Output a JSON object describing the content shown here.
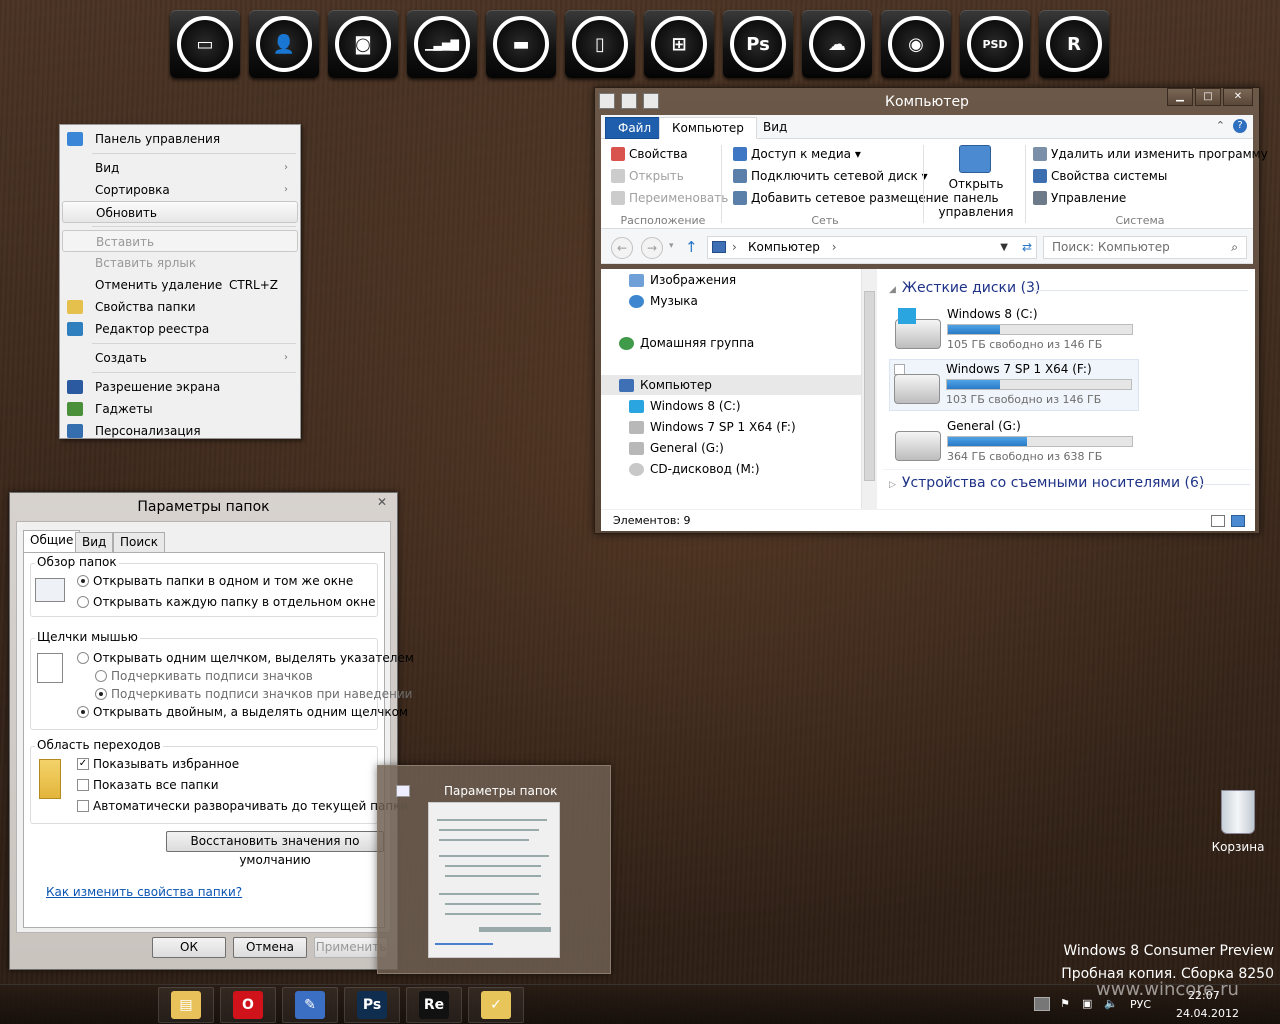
{
  "dock": {
    "icons": [
      {
        "name": "monitor-icon",
        "glyph": "▭"
      },
      {
        "name": "user-icon",
        "glyph": "👤"
      },
      {
        "name": "camera-icon",
        "glyph": "◙"
      },
      {
        "name": "signal-bars-icon",
        "glyph": "▁▃▅▇"
      },
      {
        "name": "folder-icon",
        "glyph": "▬"
      },
      {
        "name": "phone-icon",
        "glyph": "▯"
      },
      {
        "name": "windows-logo-icon",
        "glyph": "⊞"
      },
      {
        "name": "photoshop-icon",
        "glyph": "Ps"
      },
      {
        "name": "cloud-icon",
        "glyph": "☁"
      },
      {
        "name": "eye-icon",
        "glyph": "◉"
      },
      {
        "name": "psd-file-icon",
        "glyph": "PSD"
      },
      {
        "name": "registered-icon",
        "glyph": "R"
      }
    ]
  },
  "context_menu": {
    "items": [
      {
        "label": "Панель управления",
        "icon": "control-panel-icon"
      },
      {
        "label": "Вид",
        "arrow": "›"
      },
      {
        "label": "Сортировка",
        "arrow": "›"
      },
      {
        "label": "Обновить"
      },
      {
        "label": "Вставить"
      },
      {
        "label": "Вставить ярлык"
      },
      {
        "label": "Отменить удаление",
        "shortcut": "CTRL+Z"
      },
      {
        "label": "Свойства папки",
        "icon": "folder-options-icon"
      },
      {
        "label": "Редактор реестра",
        "icon": "registry-editor-icon"
      },
      {
        "label": "Создать",
        "arrow": "›"
      },
      {
        "label": "Разрешение экрана",
        "icon": "screen-resolution-icon"
      },
      {
        "label": "Гаджеты",
        "icon": "gadgets-icon"
      },
      {
        "label": "Персонализация",
        "icon": "personalization-icon"
      }
    ]
  },
  "explorer": {
    "title": "Компьютер",
    "caption_buttons": {
      "minimize": "▁",
      "maximize": "□",
      "close": "✕"
    },
    "tabs": {
      "file": "Файл",
      "computer": "Компьютер",
      "view": "Вид"
    },
    "ribbon": {
      "location_group": {
        "label": "Расположение",
        "properties": "Свойства",
        "open": "Открыть",
        "rename": "Переименовать"
      },
      "network_group": {
        "label": "Сеть",
        "media_access": "Доступ к медиа ▾",
        "map_drive": "Подключить сетевой диск ▾",
        "add_location": "Добавить сетевое размещение"
      },
      "open_cp": "Открыть панель управления",
      "system_group": {
        "label": "Система",
        "uninstall": "Удалить или изменить программу",
        "system_props": "Свойства системы",
        "manage": "Управление"
      }
    },
    "address": {
      "path": "Компьютер",
      "separator": "›",
      "search_placeholder": "Поиск: Компьютер"
    },
    "nav": {
      "images": "Изображения",
      "music": "Музыка",
      "homegroup": "Домашняя группа",
      "computer": "Компьютер",
      "drive_c": "Windows 8 (C:)",
      "drive_f": "Windows 7 SP 1 X64 (F:)",
      "drive_g": "General (G:)",
      "drive_m": "CD-дисковод (M:)"
    },
    "content": {
      "hard_disks_header": "Жесткие диски (3)",
      "removable_header": "Устройства со съемными носителями (6)",
      "drives": [
        {
          "name": "Windows 8 (C:)",
          "free": "105 ГБ свободно из 146 ГБ",
          "used_fraction": 0.28
        },
        {
          "name": "Windows 7 SP 1 X64 (F:)",
          "free": "103 ГБ свободно из 146 ГБ",
          "used_fraction": 0.29
        },
        {
          "name": "General (G:)",
          "free": "364 ГБ свободно из 638 ГБ",
          "used_fraction": 0.43
        }
      ]
    },
    "status": "Элементов: 9"
  },
  "folder_options": {
    "title": "Параметры папок",
    "close": "✕",
    "tabs": [
      "Общие",
      "Вид",
      "Поиск"
    ],
    "browse": {
      "title": "Обзор папок",
      "opt1": "Открывать папки в одном и том же окне",
      "opt2": "Открывать каждую папку в отдельном окне"
    },
    "clicks": {
      "title": "Щелчки мышью",
      "opt1": "Открывать одним щелчком, выделять указателем",
      "sub1": "Подчеркивать подписи значков",
      "sub2": "Подчеркивать подписи значков при наведении",
      "opt2": "Открывать двойным, а выделять одним щелчком"
    },
    "nav_pane": {
      "title": "Область переходов",
      "opt1": "Показывать избранное",
      "opt2": "Показать все папки",
      "opt3": "Автоматически разворачивать до текущей папки"
    },
    "restore_button": "Восстановить значения по умолчанию",
    "help_link": "Как изменить свойства папки?",
    "ok": "ОК",
    "cancel": "Отмена",
    "apply": "Применить"
  },
  "thumbnail": {
    "title": "Параметры папок"
  },
  "desktop": {
    "recycle_bin": "Корзина"
  },
  "watermark": {
    "line1": "Windows 8 Consumer Preview",
    "line2": "Пробная копия. Сборка 8250",
    "site": "www.wincore.ru"
  },
  "taskbar": {
    "apps": [
      {
        "name": "file-explorer-icon",
        "glyph": "▤",
        "color": "#e8c15a"
      },
      {
        "name": "opera-icon",
        "glyph": "O",
        "color": "#d0121a"
      },
      {
        "name": "remote-desktop-icon",
        "glyph": "✎",
        "color": "#3a6fc4"
      },
      {
        "name": "photoshop-icon",
        "glyph": "Ps",
        "color": "#0f2e4f"
      },
      {
        "name": "reflector-icon",
        "glyph": "Re",
        "color": "#111"
      },
      {
        "name": "notes-folder-icon",
        "glyph": "✓",
        "color": "#e7c55b"
      }
    ],
    "language": "РУС",
    "time": "22:07",
    "date": "24.04.2012"
  }
}
